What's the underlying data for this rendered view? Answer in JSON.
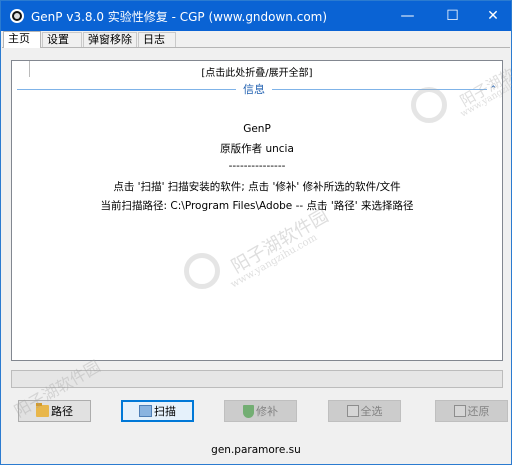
{
  "window": {
    "title": "GenP v3.8.0 实验性修复 - CGP (www.gndown.com)",
    "controls": {
      "minimize": "—",
      "maximize": "☐",
      "close": "✕"
    }
  },
  "tabs": [
    {
      "label": "主页",
      "active": true
    },
    {
      "label": "设置",
      "active": false
    },
    {
      "label": "弹窗移除",
      "active": false
    },
    {
      "label": "日志",
      "active": false
    }
  ],
  "main": {
    "fold_toggle": "[点击此处折叠/展开全部]",
    "section_title": "信息",
    "collapse_glyph": "⌃",
    "info": {
      "name": "GenP",
      "author": "原版作者 uncia",
      "separator": "---------------",
      "instruction": "点击 '扫描' 扫描安装的软件; 点击 '修补' 修补所选的软件/文件",
      "scan_path": "当前扫描路径: C:\\Program Files\\Adobe -- 点击 '路径' 来选择路径"
    },
    "progress": 0
  },
  "buttons": {
    "path": {
      "label": "路径",
      "icon": "folder-icon"
    },
    "scan": {
      "label": "扫描",
      "icon": "scan-icon"
    },
    "patch": {
      "label": "修补",
      "icon": "shield-icon"
    },
    "select_all": {
      "label": "全选",
      "icon": "checkall-icon"
    },
    "restore": {
      "label": "还原",
      "icon": "restore-icon"
    }
  },
  "footer": {
    "url": "gen.paramore.su"
  },
  "watermark": {
    "text_cn": "阳子湖软件园",
    "text_url": "www.yangzihu.com"
  },
  "colors": {
    "titlebar": "#0a63d4",
    "accent": "#1f5fb0",
    "button_primary_border": "#0078d7"
  }
}
